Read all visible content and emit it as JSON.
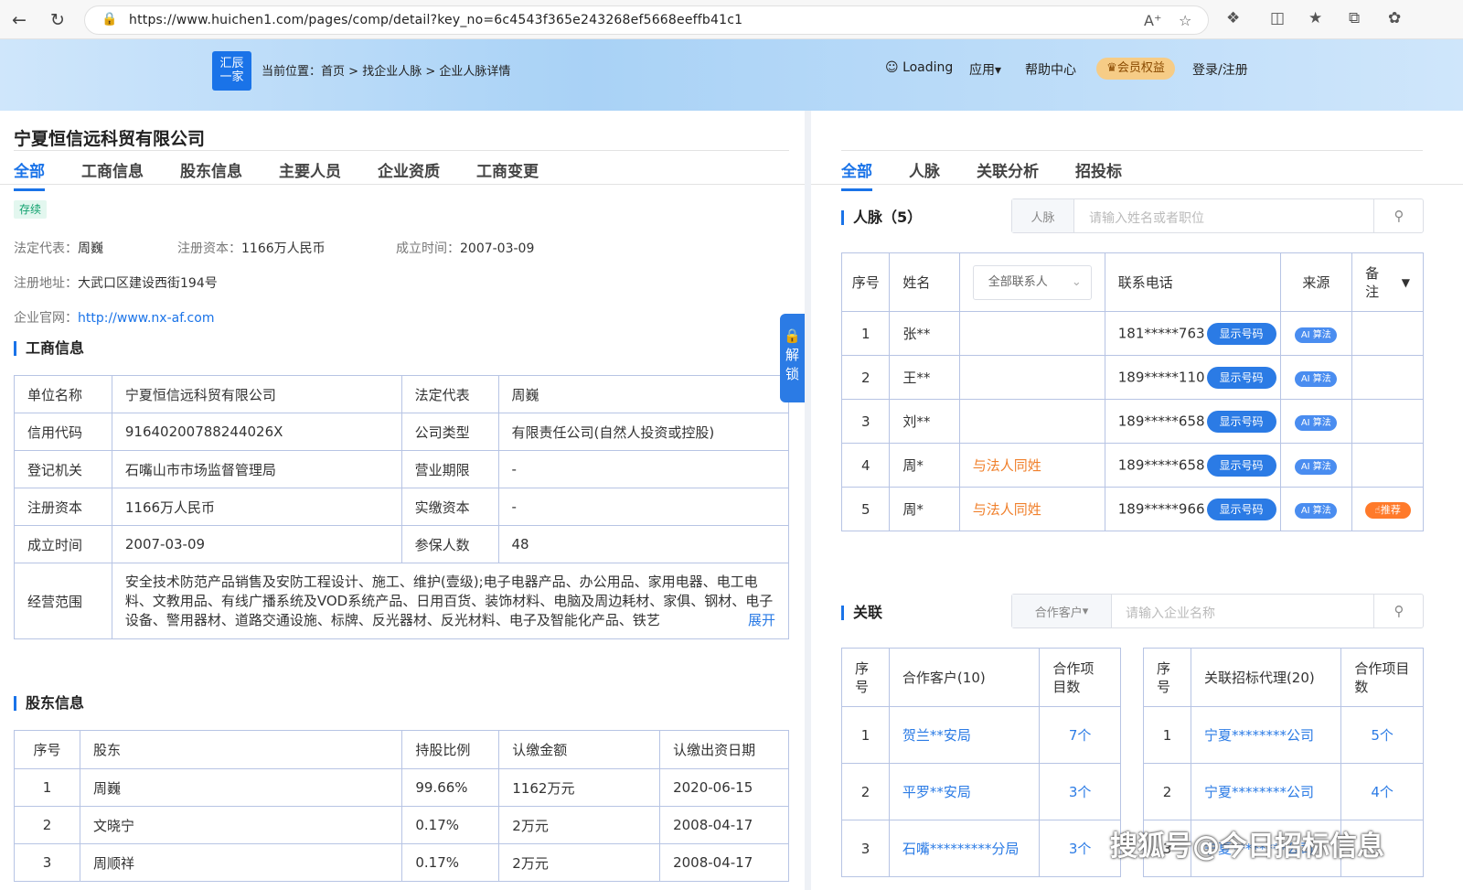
{
  "browser": {
    "url": "https://www.huichen1.com/pages/comp/detail?key_no=6c4543f365e243268ef5668eeffb41c1"
  },
  "header": {
    "logo_line1": "汇辰",
    "logo_line2": "一家",
    "crumb_prefix": "当前位置：",
    "crumb_home": "首页",
    "crumb_sep": ">",
    "crumb_find": "找企业人脉",
    "crumb_detail": "企业人脉详情",
    "loading": "Loading",
    "apps": "应用",
    "help": "帮助中心",
    "vip": "会员权益",
    "login": "登录/注册"
  },
  "company": {
    "name": "宁夏恒信远科贸有限公司",
    "status": "存续",
    "legal_label": "法定代表：",
    "legal": "周巍",
    "capital_label": "注册资本：",
    "capital": "1166万人民币",
    "founded_label": "成立时间：",
    "founded": "2007-03-09",
    "address_label": "注册地址：",
    "address": "大武口区建设西街194号",
    "website_label": "企业官网：",
    "website": "http://www.nx-af.com"
  },
  "left_tabs": [
    "全部",
    "工商信息",
    "股东信息",
    "主要人员",
    "企业资质",
    "工商变更"
  ],
  "unlock": [
    "解",
    "锁"
  ],
  "biz": {
    "title": "工商信息",
    "rows": [
      [
        "单位名称",
        "宁夏恒信远科贸有限公司",
        "法定代表",
        "周巍"
      ],
      [
        "信用代码",
        "91640200788244026X",
        "公司类型",
        "有限责任公司(自然人投资或控股)"
      ],
      [
        "登记机关",
        "石嘴山市市场监督管理局",
        "营业期限",
        "-"
      ],
      [
        "注册资本",
        "1166万人民币",
        "实缴资本",
        "-"
      ],
      [
        "成立时间",
        "2007-03-09",
        "参保人数",
        "48"
      ]
    ],
    "scope_label": "经营范围",
    "scope": "安全技术防范产品销售及安防工程设计、施工、维护(壹级);电子电器产品、办公用品、家用电器、电工电料、文教用品、有线广播系统及VOD系统产品、日用百货、装饰材料、电脑及周边耗材、家俱、钢材、电子设备、警用器材、道路交通设施、标牌、反光器材、反光材料、电子及智能化产品、铁艺",
    "expand": "展开"
  },
  "shareholders": {
    "title": "股东信息",
    "headers": [
      "序号",
      "股东",
      "持股比例",
      "认缴金额",
      "认缴出资日期"
    ],
    "rows": [
      [
        "1",
        "周巍",
        "99.66%",
        "1162万元",
        "2020-06-15"
      ],
      [
        "2",
        "文晓宁",
        "0.17%",
        "2万元",
        "2008-04-17"
      ],
      [
        "3",
        "周顺祥",
        "0.17%",
        "2万元",
        "2008-04-17"
      ]
    ]
  },
  "right_tabs": [
    "全部",
    "人脉",
    "关联分析",
    "招投标"
  ],
  "contacts": {
    "title": "人脉（5）",
    "search_label": "人脉",
    "search_placeholder": "请输入姓名或者职位",
    "headers": {
      "no": "序号",
      "name": "姓名",
      "filter": "全部联系人",
      "phone": "联系电话",
      "source": "来源",
      "note": "备注"
    },
    "show_btn": "显示号码",
    "ai": "算法",
    "rows": [
      {
        "no": "1",
        "name": "张**",
        "tag": "",
        "phone": "181*****763",
        "note": ""
      },
      {
        "no": "2",
        "name": "王**",
        "tag": "",
        "phone": "189*****110",
        "note": ""
      },
      {
        "no": "3",
        "name": "刘**",
        "tag": "",
        "phone": "189*****658",
        "note": ""
      },
      {
        "no": "4",
        "name": "周*",
        "tag": "与法人同姓",
        "phone": "189*****658",
        "note": ""
      },
      {
        "no": "5",
        "name": "周*",
        "tag": "与法人同姓",
        "phone": "189*****966",
        "note": "推荐"
      }
    ]
  },
  "relations": {
    "title": "关联",
    "filter": "合作客户",
    "search_placeholder": "请输入企业名称",
    "clients": {
      "headers": [
        "序号",
        "合作客户(10)",
        "合作项目数"
      ],
      "rows": [
        [
          "1",
          "贺兰**安局",
          "7个"
        ],
        [
          "2",
          "平罗**安局",
          "3个"
        ],
        [
          "3",
          "石嘴*********分局",
          "3个"
        ]
      ]
    },
    "agents": {
      "headers": [
        "序号",
        "关联招标代理(20)",
        "合作项目数"
      ],
      "rows": [
        [
          "1",
          "宁夏********公司",
          "5个"
        ],
        [
          "2",
          "宁夏********公司",
          "4个"
        ],
        [
          "3",
          "宁夏********公司",
          ""
        ]
      ]
    }
  },
  "watermark": "搜狐号@今日招标信息"
}
